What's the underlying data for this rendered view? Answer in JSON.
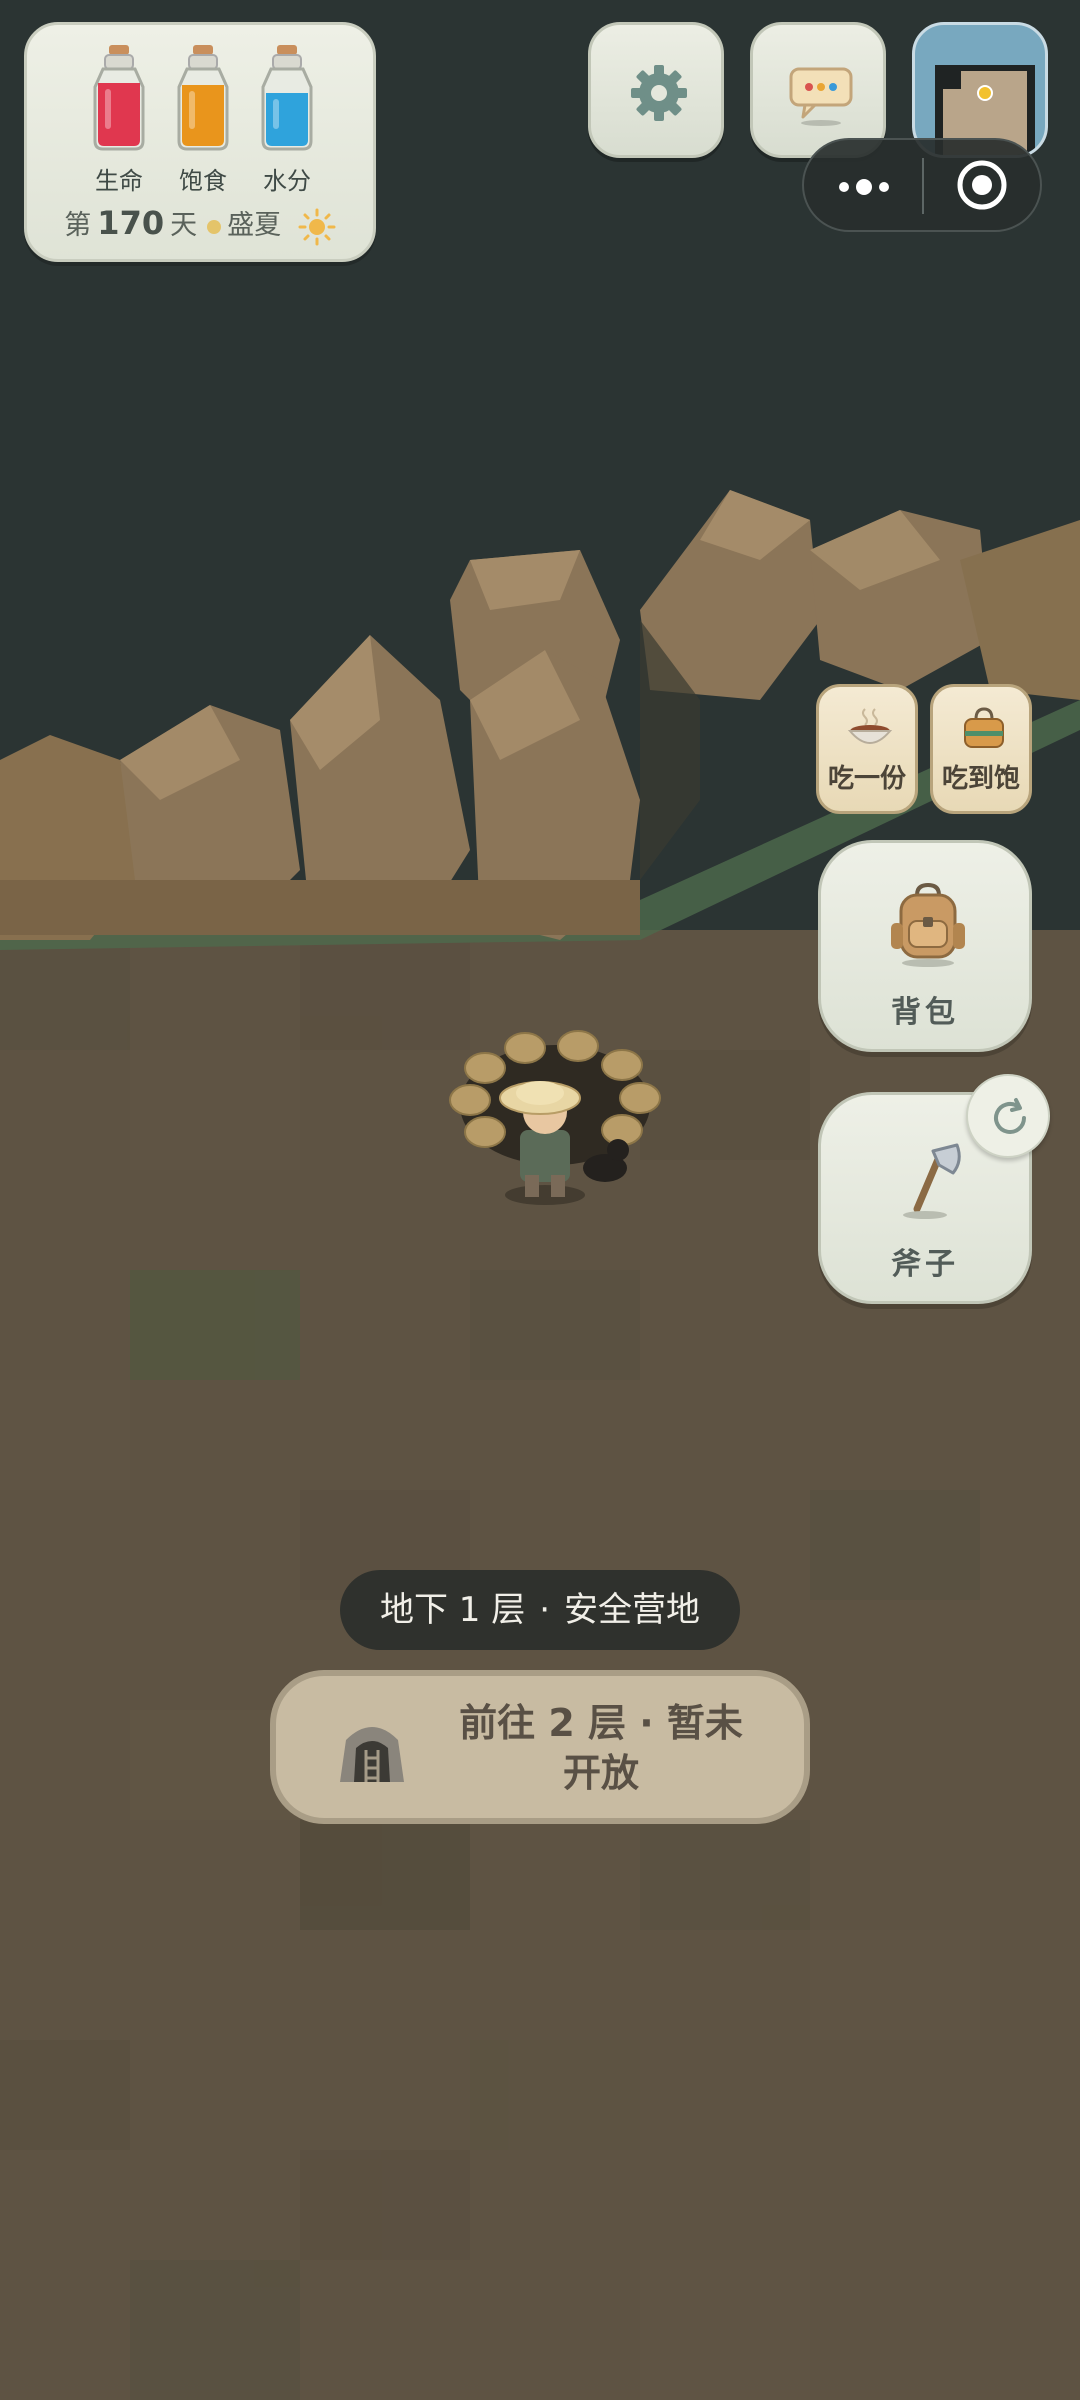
{
  "status": {
    "bottles": [
      {
        "label": "生命",
        "color": "#e0374f"
      },
      {
        "label": "饱食",
        "color": "#e9951c"
      },
      {
        "label": "水分",
        "color": "#2fa3dc"
      }
    ],
    "day_prefix": "第",
    "day_number": "170",
    "day_suffix": "天",
    "season": "盛夏"
  },
  "food": {
    "eat_one": "吃一份",
    "eat_full": "吃到饱"
  },
  "actions": {
    "backpack": "背包",
    "tool": "斧子"
  },
  "location": {
    "floor": "地下 1 层",
    "separator": "·",
    "place": "安全营地"
  },
  "next_floor": {
    "line1": "前往 2 层 · 暂未",
    "line2": "开放"
  },
  "colors": {
    "sky": "#2b3433",
    "ground": "#5e5343",
    "rock": "#8b7558"
  }
}
